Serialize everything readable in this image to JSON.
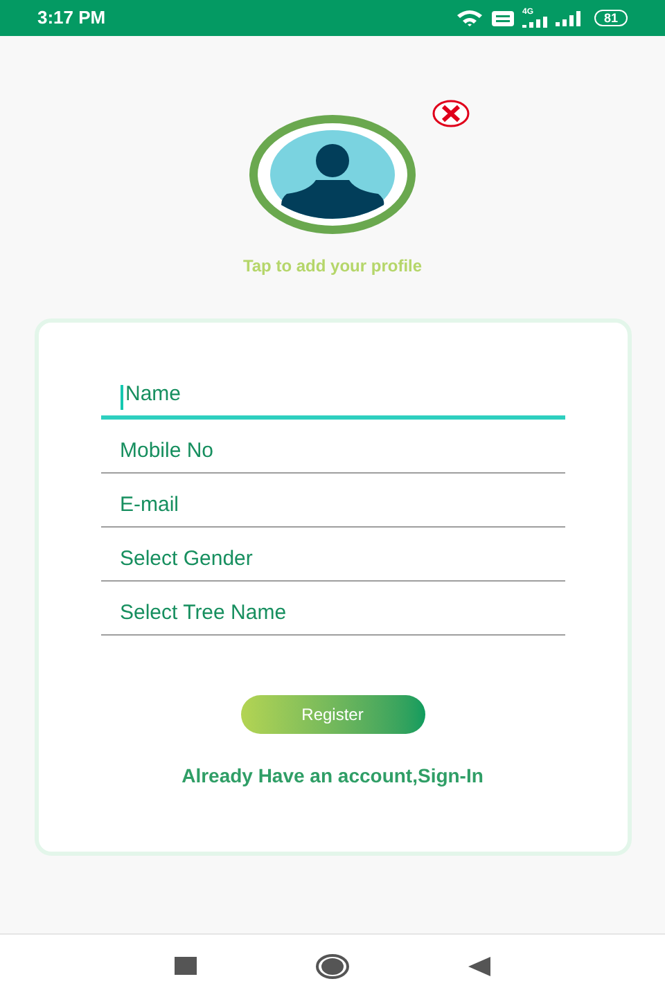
{
  "status_bar": {
    "time": "3:17 PM",
    "network": "4G",
    "battery": "81"
  },
  "profile": {
    "caption": "Tap to add your profile"
  },
  "form": {
    "fields": [
      {
        "placeholder": "Name",
        "focused": true
      },
      {
        "placeholder": "Mobile No",
        "focused": false
      },
      {
        "placeholder": "E-mail",
        "focused": false
      },
      {
        "placeholder": "Select Gender",
        "focused": false
      },
      {
        "placeholder": "Select Tree Name",
        "focused": false
      }
    ],
    "register_button": "Register",
    "signin_link": "Already Have an account,Sign-In"
  }
}
